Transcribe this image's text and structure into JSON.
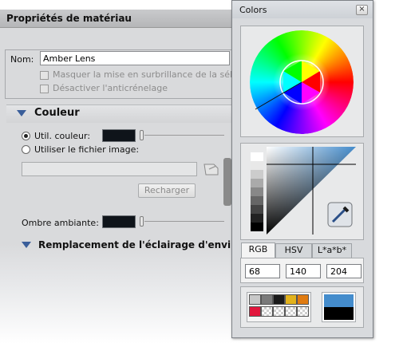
{
  "material_panel": {
    "title": "Propriétés de matériau",
    "name_label": "Nom:",
    "name_value": "Amber Lens",
    "hide_highlight_label": "Masquer la mise en surbrillance de la sélection",
    "disable_antialias_label": "Désactiver l'anticrénelage",
    "color_section_title": "Couleur",
    "use_color_label": "Util. couleur:",
    "use_image_label": "Utiliser le fichier image:",
    "reload_button": "Recharger",
    "ambient_label": "Ombre ambiante:",
    "env_section_title": "Remplacement de l'éclairage d'environnement",
    "color_swatch": "#0f141a"
  },
  "colors_window": {
    "title": "Colors",
    "close_glyph": "×",
    "tabs": [
      "RGB",
      "HSV",
      "L*a*b*"
    ],
    "active_tab": "RGB",
    "rgb_values": [
      "68",
      "140",
      "204"
    ],
    "current_color": "#448ccc",
    "previous_color": "#000000",
    "icons": [
      "close-icon",
      "eyedropper-icon"
    ],
    "swatches_row1": [
      "#c8c8c8",
      "#7a7a7a",
      "#1a1a1a",
      "#e2b21c",
      "#e07b10"
    ],
    "swatches_row2": [
      "#e2163c",
      "checker",
      "checker",
      "checker",
      "checker"
    ]
  }
}
